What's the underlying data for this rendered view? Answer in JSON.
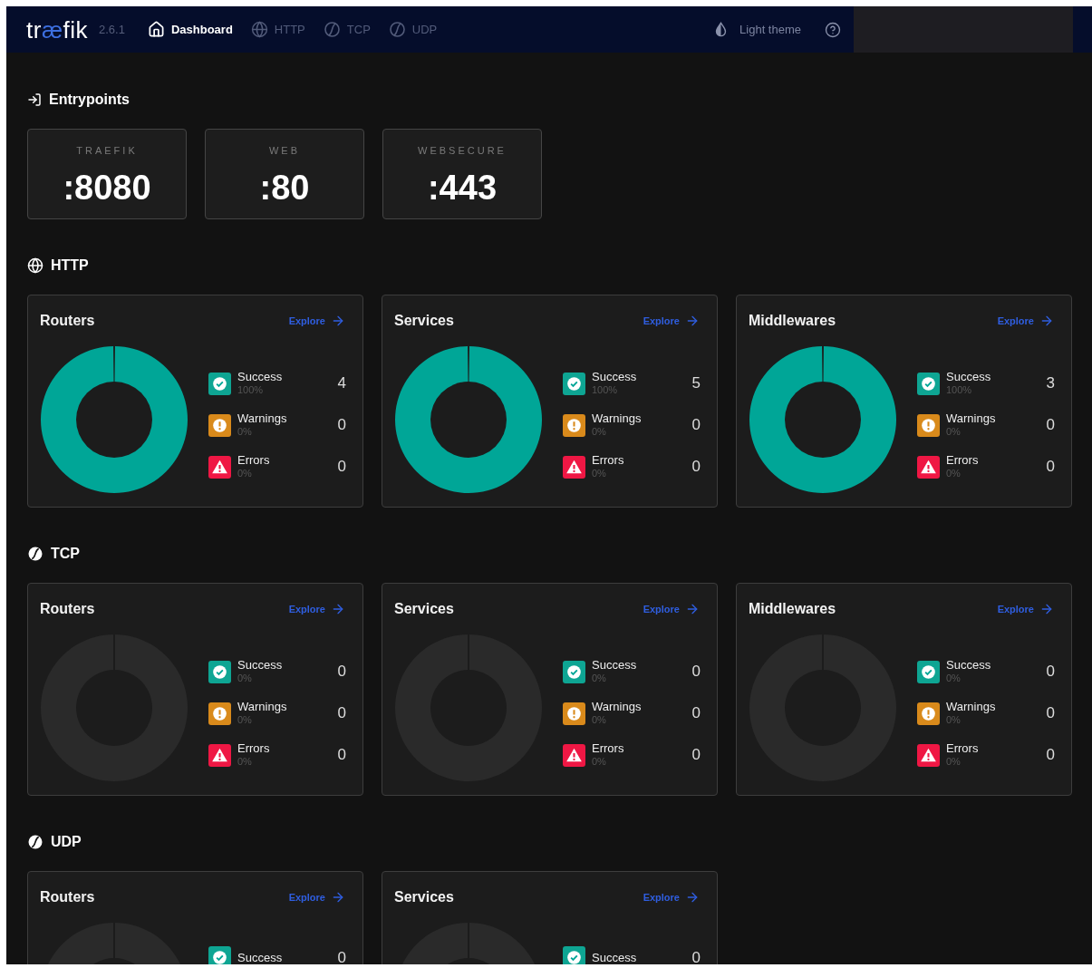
{
  "header": {
    "logo": [
      {
        "text": "tr",
        "accent": false
      },
      {
        "text": "æ",
        "accent": true
      },
      {
        "text": "fik",
        "accent": false
      }
    ],
    "version": "2.6.1",
    "nav": [
      {
        "kind": "home",
        "label": "Dashboard",
        "selected": true
      },
      {
        "kind": "globe",
        "label": "HTTP",
        "selected": false
      },
      {
        "kind": "ball",
        "label": "TCP",
        "selected": false
      },
      {
        "kind": "ball",
        "label": "UDP",
        "selected": false
      }
    ],
    "theme_toggle": "Light theme"
  },
  "entrypoints": {
    "title": "Entrypoints",
    "items": [
      {
        "name": "TRAEFIK",
        "port": ":8080"
      },
      {
        "name": "WEB",
        "port": ":80"
      },
      {
        "name": "WEBSECURE",
        "port": ":443"
      }
    ]
  },
  "sections": [
    {
      "title": "HTTP",
      "kind": "globe",
      "cards": [
        {
          "title": "Routers",
          "explore": "Explore",
          "chart_data": {
            "type": "donut",
            "categories": [
              "Success",
              "Warnings",
              "Errors"
            ],
            "values": [
              100,
              0,
              0
            ]
          },
          "legend": [
            {
              "kind": "success",
              "percent": "100%",
              "count": "4"
            },
            {
              "kind": "warning",
              "percent": "0%",
              "count": "0"
            },
            {
              "kind": "error",
              "percent": "0%",
              "count": "0"
            }
          ]
        },
        {
          "title": "Services",
          "explore": "Explore",
          "chart_data": {
            "type": "donut",
            "categories": [
              "Success",
              "Warnings",
              "Errors"
            ],
            "values": [
              100,
              0,
              0
            ]
          },
          "legend": [
            {
              "kind": "success",
              "percent": "100%",
              "count": "5"
            },
            {
              "kind": "warning",
              "percent": "0%",
              "count": "0"
            },
            {
              "kind": "error",
              "percent": "0%",
              "count": "0"
            }
          ]
        },
        {
          "title": "Middlewares",
          "explore": "Explore",
          "chart_data": {
            "type": "donut",
            "categories": [
              "Success",
              "Warnings",
              "Errors"
            ],
            "values": [
              100,
              0,
              0
            ]
          },
          "legend": [
            {
              "kind": "success",
              "percent": "100%",
              "count": "3"
            },
            {
              "kind": "warning",
              "percent": "0%",
              "count": "0"
            },
            {
              "kind": "error",
              "percent": "0%",
              "count": "0"
            }
          ]
        }
      ]
    },
    {
      "title": "TCP",
      "kind": "ball",
      "cards": [
        {
          "title": "Routers",
          "explore": "Explore",
          "legend": [
            {
              "kind": "success",
              "label": "Success",
              "percent": "0%",
              "count": "0"
            },
            {
              "kind": "warning",
              "label": "Warnings",
              "percent": "0%",
              "count": "0"
            },
            {
              "kind": "error",
              "label": "Errors",
              "percent": "0%",
              "count": "0"
            }
          ]
        },
        {
          "title": "Services",
          "explore": "Explore",
          "legend": [
            {
              "kind": "success",
              "label": "Success",
              "percent": "0%",
              "count": "0"
            },
            {
              "kind": "warning",
              "label": "Warnings",
              "percent": "0%",
              "count": "0"
            },
            {
              "kind": "error",
              "label": "Errors",
              "percent": "0%",
              "count": "0"
            }
          ]
        },
        {
          "title": "Middlewares",
          "explore": "Explore",
          "legend": [
            {
              "kind": "success",
              "label": "Success",
              "percent": "0%",
              "count": "0"
            },
            {
              "kind": "warning",
              "label": "Warnings",
              "percent": "0%",
              "count": "0"
            },
            {
              "kind": "error",
              "label": "Errors",
              "percent": "0%",
              "count": "0"
            }
          ]
        }
      ]
    },
    {
      "title": "UDP",
      "kind": "ball",
      "cards": [
        {
          "title": "Routers",
          "explore": "Explore",
          "legend": [
            {
              "kind": "success",
              "label": "Success",
              "count": "0"
            }
          ]
        },
        {
          "title": "Services",
          "explore": "Explore",
          "legend": [
            {
              "kind": "success",
              "label": "Success",
              "count": "0"
            }
          ]
        }
      ]
    }
  ]
}
